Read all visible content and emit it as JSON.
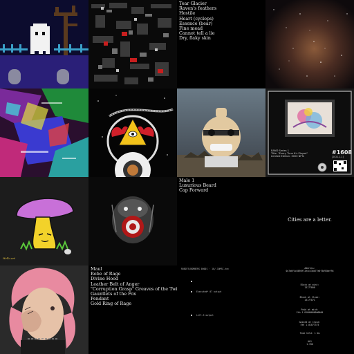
{
  "grid": {
    "tile_count": 16,
    "icons": [
      "ghost-pixel-art",
      "glitch-pixel-art",
      "starfield-image",
      "glitch-collage",
      "astronaut-triangle-art",
      "clay-figure-photo",
      "framed-artwork-card",
      "mushroom-character",
      "gorilla-robot-art",
      "portrait-photo",
      "hexagon-logo"
    ]
  },
  "tile_traits_1": {
    "lines": [
      "Tear Glacier",
      "Raven's feathers",
      "Hostile",
      "Heart (cyclops)",
      "Essence (bear)",
      "Fine mead",
      "Cannot tell a lie",
      "Dry, flaky skin"
    ]
  },
  "tile_card": {
    "header": "BAND Series 1",
    "title": "Title: \"Every Time It's Played\"",
    "edition": "Limited Edition: 3000 NFTs",
    "number": "#1608",
    "series_year": "[2021-1.1]"
  },
  "tile_traits_2": {
    "lines": [
      "Male 1",
      "Luxurious Beard",
      "Cap Forward"
    ]
  },
  "tile_cities": {
    "text": "Cities are a letter."
  },
  "tile_mushroom": {
    "signature": "Hello.art"
  },
  "tile_items": {
    "lines": [
      "Maul",
      "Robe of Rage",
      "Divine Hood",
      "Leather Belt of Anger",
      "\"Corruption Grasp\" Greaves of the Twins +1",
      "Gauntlets of the Fox",
      "Pendant",
      "Gold Ring of Rage"
    ]
  },
  "tile_terminal": {
    "line1": "ROBOTS/BOMBERS 00001 · 10/-10MSC-tec",
    "line2": "Executed* 07 output",
    "line3": "Left-5 output"
  },
  "tile_stats": {
    "address_label": "Address:",
    "address_value": "0x7a6f4c8098f72e4c23bd77e0f3a93bef94",
    "block_label": "Block at mint:",
    "block_value": "13177800",
    "block_close_label": "Block at Close:",
    "block_close_value": "13177871",
    "paid_label": "Paid at mint:",
    "paid_value": "Eth 1.01000000000000",
    "gained_label": "Gained at Close:",
    "gained_value": "Eth 1.01077375",
    "time_label": "Time held: 1 Ow",
    "row_label": "001",
    "row_value": "1.706"
  }
}
